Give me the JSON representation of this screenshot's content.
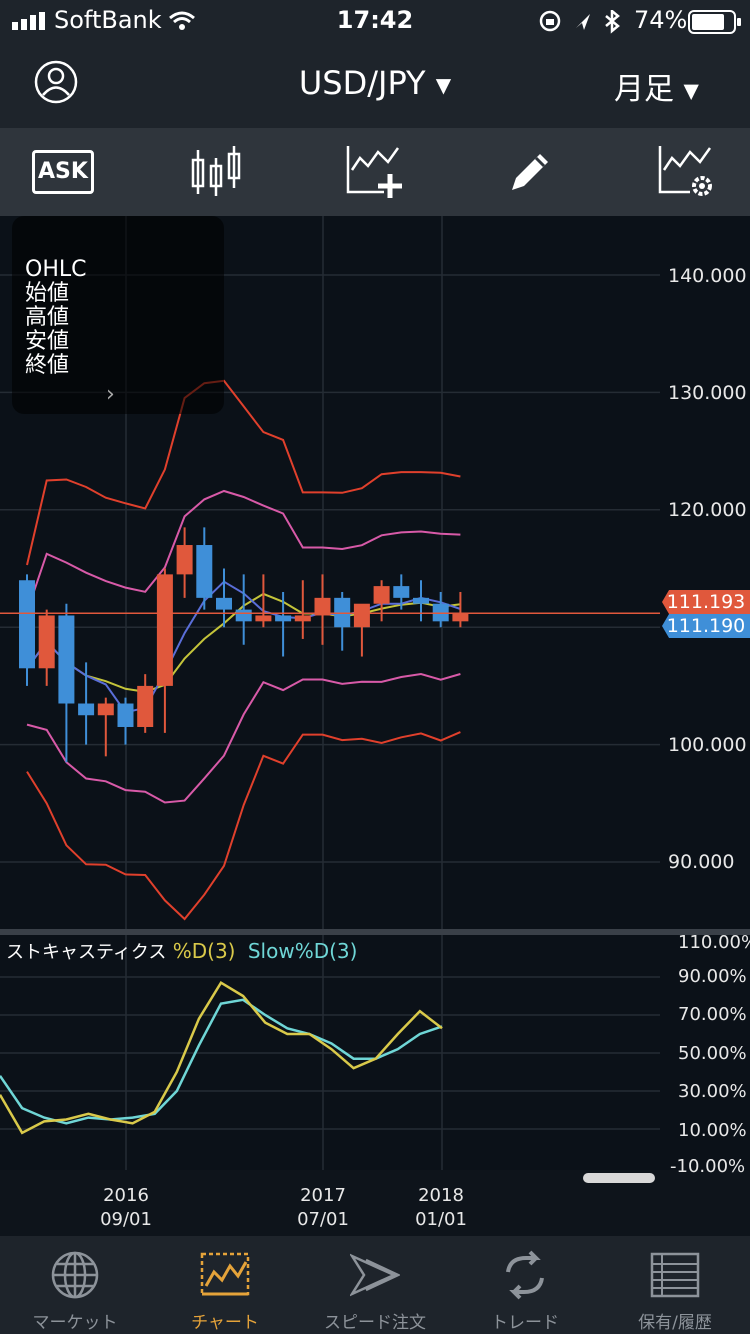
{
  "status_bar": {
    "carrier": "SoftBank",
    "time": "17:42",
    "battery": "74%"
  },
  "header": {
    "pair": "USD/JPY",
    "period": "月足"
  },
  "toolbar": {
    "ask_label": "ASK"
  },
  "ohlc_panel": {
    "lines": [
      "OHLC",
      "始値",
      "高値",
      "安値",
      "終値"
    ]
  },
  "price_axis": {
    "ticks": [
      "140.000",
      "130.000",
      "120.000",
      "100.000",
      "90.000"
    ],
    "tag_ask": "111.193",
    "tag_bid": "111.190",
    "ask_color": "#e0583c",
    "bid_color": "#3f8fd8"
  },
  "stochastics": {
    "title": "ストキャスティクス",
    "series_d": "%D(3)",
    "series_slow": "Slow%D(3)",
    "color_d": "#d9c94a",
    "color_slow": "#6fd6d6",
    "ticks": [
      "110.00%",
      "90.00%",
      "70.00%",
      "50.00%",
      "30.00%",
      "10.00%",
      "-10.00%"
    ]
  },
  "x_axis": {
    "labels": [
      {
        "year": "2016",
        "date": "09/01"
      },
      {
        "year": "2017",
        "date": "07/01"
      },
      {
        "year": "2018",
        "date": "01/01"
      }
    ]
  },
  "tabs": [
    {
      "label": "マーケット",
      "icon": "globe-icon"
    },
    {
      "label": "チャート",
      "icon": "chart-icon"
    },
    {
      "label": "スピード注文",
      "icon": "speed-order-icon"
    },
    {
      "label": "トレード",
      "icon": "trade-icon"
    },
    {
      "label": "保有/履歴",
      "icon": "history-icon"
    }
  ],
  "chart_data": {
    "type": "candlestick",
    "title": "USD/JPY 月足",
    "y_range": [
      85,
      145
    ],
    "candles": [
      {
        "o": 114.0,
        "h": 114.5,
        "l": 105.0,
        "c": 106.5
      },
      {
        "o": 106.5,
        "h": 111.5,
        "l": 105.0,
        "c": 111.0
      },
      {
        "o": 111.0,
        "h": 112.0,
        "l": 98.5,
        "c": 103.5
      },
      {
        "o": 103.5,
        "h": 107.0,
        "l": 100.0,
        "c": 102.5
      },
      {
        "o": 102.5,
        "h": 104.0,
        "l": 99.0,
        "c": 103.5
      },
      {
        "o": 103.5,
        "h": 104.0,
        "l": 100.0,
        "c": 101.5
      },
      {
        "o": 101.5,
        "h": 106.0,
        "l": 101.0,
        "c": 105.0
      },
      {
        "o": 105.0,
        "h": 115.0,
        "l": 101.0,
        "c": 114.5
      },
      {
        "o": 114.5,
        "h": 118.5,
        "l": 112.5,
        "c": 117.0
      },
      {
        "o": 117.0,
        "h": 118.5,
        "l": 111.5,
        "c": 112.5
      },
      {
        "o": 112.5,
        "h": 115.0,
        "l": 110.0,
        "c": 111.5
      },
      {
        "o": 111.5,
        "h": 114.5,
        "l": 108.5,
        "c": 110.5
      },
      {
        "o": 110.5,
        "h": 114.5,
        "l": 110.0,
        "c": 111.0
      },
      {
        "o": 111.0,
        "h": 113.0,
        "l": 107.5,
        "c": 110.5
      },
      {
        "o": 110.5,
        "h": 114.0,
        "l": 109.0,
        "c": 111.0
      },
      {
        "o": 111.0,
        "h": 114.5,
        "l": 108.5,
        "c": 112.5
      },
      {
        "o": 112.5,
        "h": 113.0,
        "l": 108.0,
        "c": 110.0
      },
      {
        "o": 110.0,
        "h": 111.5,
        "l": 107.5,
        "c": 112.0
      },
      {
        "o": 112.0,
        "h": 114.0,
        "l": 110.5,
        "c": 113.5
      },
      {
        "o": 113.5,
        "h": 114.5,
        "l": 111.5,
        "c": 112.5
      },
      {
        "o": 112.5,
        "h": 114.0,
        "l": 110.5,
        "c": 112.0
      },
      {
        "o": 112.0,
        "h": 113.0,
        "l": 110.0,
        "c": 110.5
      },
      {
        "o": 110.5,
        "h": 113.0,
        "l": 110.0,
        "c": 111.19
      }
    ],
    "stoch_d": [
      28,
      8,
      14,
      15,
      18,
      15,
      13,
      19,
      40,
      68,
      87,
      80,
      66,
      60,
      60,
      52,
      42,
      47,
      60,
      72,
      63
    ],
    "stoch_slow": [
      38,
      21,
      16,
      13,
      16,
      15,
      16,
      18,
      30,
      54,
      76,
      78,
      70,
      63,
      60,
      55,
      47,
      47,
      52,
      60,
      64
    ]
  }
}
